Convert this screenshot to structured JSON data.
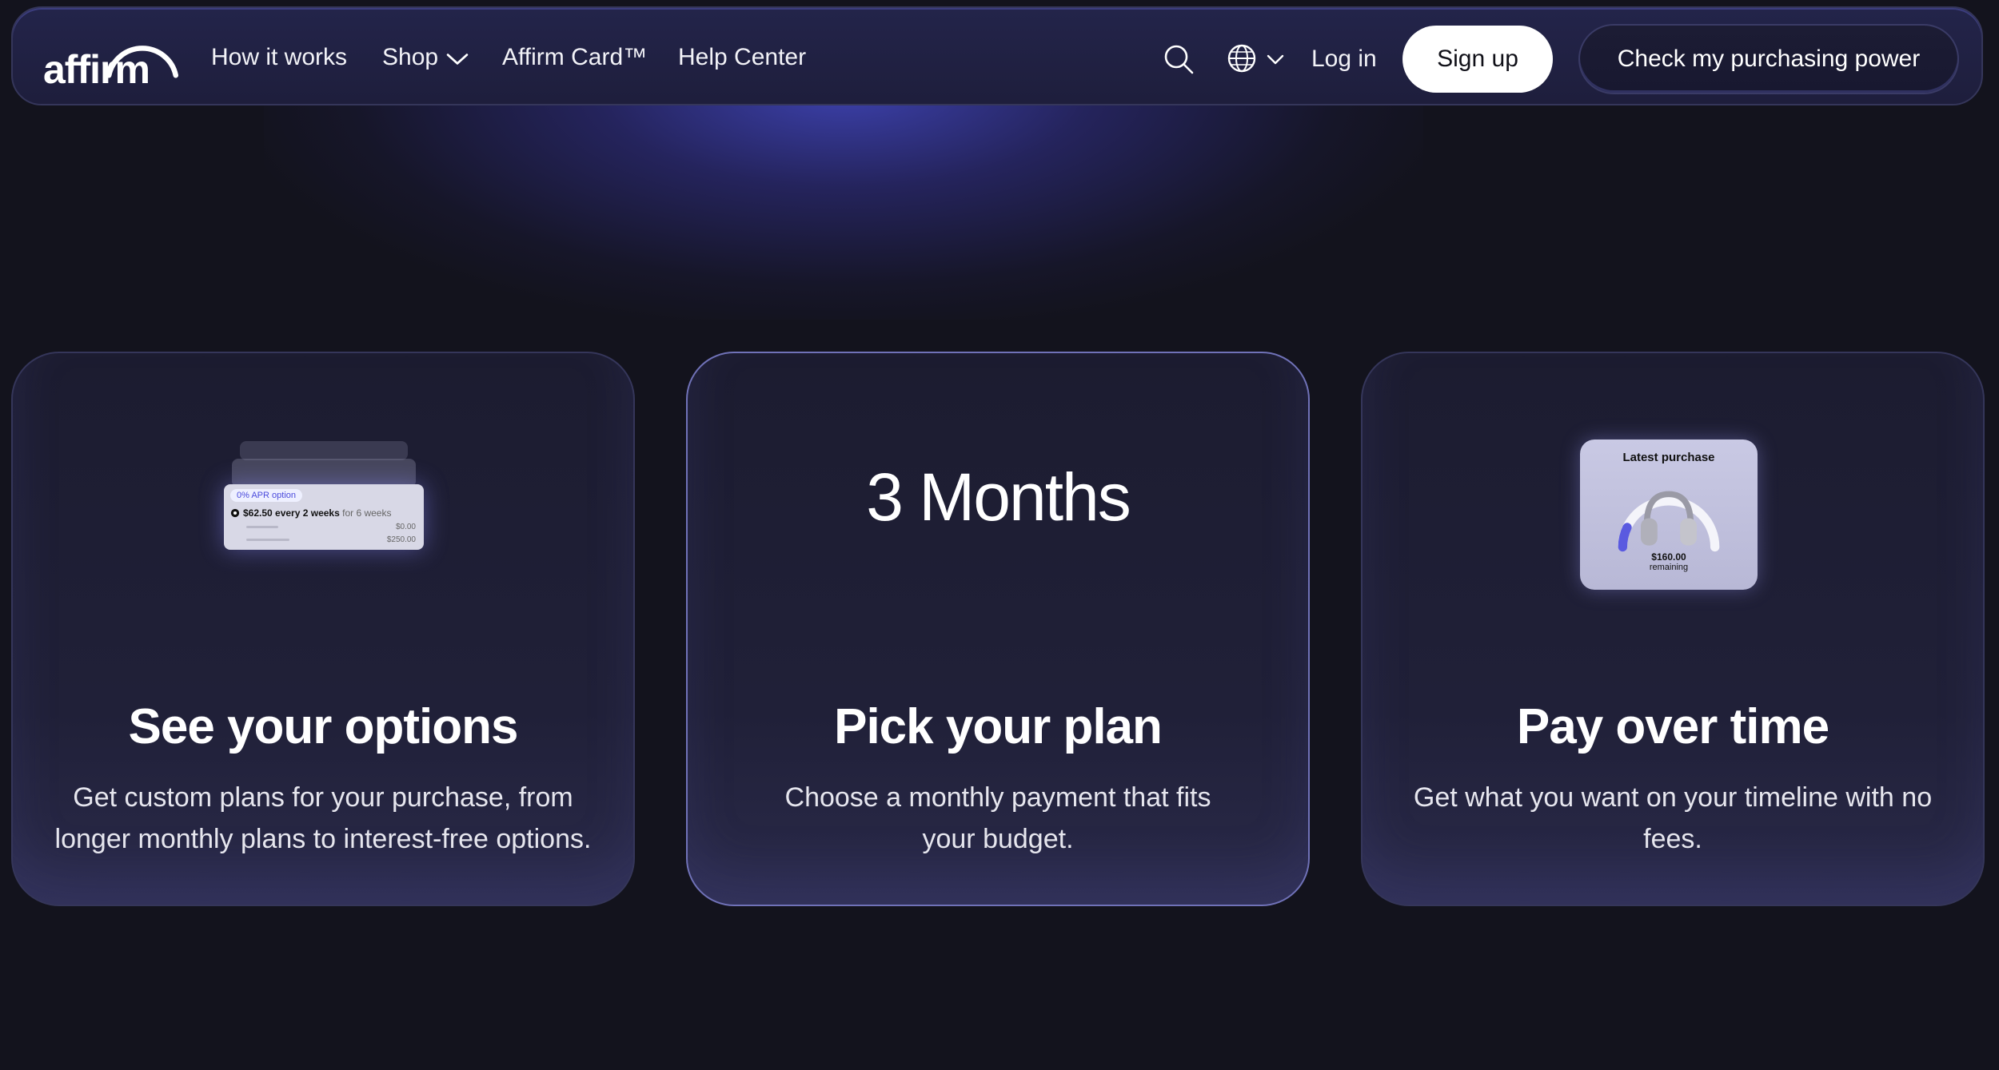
{
  "nav": {
    "logo": "affirm",
    "links": [
      "How it works",
      "Shop",
      "Affirm Card™",
      "Help Center"
    ],
    "login": "Log in",
    "signup": "Sign up",
    "cta": "Check my purchasing power"
  },
  "cards": [
    {
      "title": "See your options",
      "desc": "Get custom plans for your purchase, from longer monthly plans to interest-free options.",
      "illustration": {
        "apr": "0% APR option",
        "payment": "$62.50 every 2 weeks",
        "duration": "for 6 weeks",
        "amount1": "$0.00",
        "amount2": "$250.00"
      }
    },
    {
      "title": "Pick your plan",
      "desc": "Choose a monthly payment that fits your budget.",
      "headline": "3 Months"
    },
    {
      "title": "Pay over time",
      "desc": "Get what you want on your timeline with no fees.",
      "widget": {
        "title": "Latest purchase",
        "amount": "$160.00",
        "caption": "remaining"
      }
    }
  ],
  "colors": {
    "background": "#13131d",
    "nav_bg": "#1e1e3c",
    "accent_glow": "#4a50dc",
    "card_border_active": "#7072b8"
  }
}
